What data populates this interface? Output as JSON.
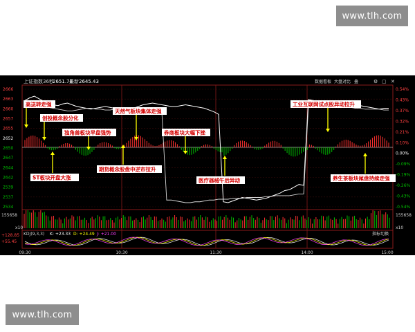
{
  "watermarks": {
    "top": "www.tlh.com",
    "bottom": "www.tlh.com"
  },
  "header": {
    "index_name": "上证指数",
    "index_sub": "36秒",
    "price": "2651.78",
    "label": "最新",
    "value2": "2645.43",
    "right_items": [
      "数据看板",
      "大盘对比",
      "叠"
    ]
  },
  "indicator": {
    "name": "KDJ(9,3,3)",
    "k": "K: +23.33",
    "d": "D: +24.49",
    "j": "J: +21.00",
    "tag": "指标切换",
    "y_labels": [
      "+128.85",
      "+55.45"
    ]
  },
  "volume": {
    "left_label": "155658",
    "right_label": "155658",
    "unit": "x10"
  },
  "colors": {
    "background": "#000000",
    "up": "#ff3030",
    "down": "#00c000",
    "index_line": "#ffffff",
    "avg_line": "#d8d8d8",
    "annotation_bg": "#ffffff",
    "annotation_text": "#d40000",
    "arrow": "#ffff00"
  },
  "chart_data": {
    "type": "line",
    "title": "",
    "xlabel": "",
    "ylabel": "",
    "x_ticks": [
      "09:30",
      "10:30",
      "11:30",
      "14:00",
      "15:00"
    ],
    "y_ticks_left": [
      "2666",
      "2663",
      "2660",
      "2657",
      "2655",
      "2652",
      "2650",
      "2647",
      "2644",
      "2642",
      "2539",
      "2537",
      "2534"
    ],
    "y_ticks_right": [
      "0.54%",
      "0.43%",
      "0.37%",
      "0.32%",
      "0.21%",
      "0.10%",
      "0.00%",
      "-0.09%",
      "-0.19%",
      "-0.26%",
      "-0.43%",
      "-0.54%"
    ],
    "ylim": [
      2533,
      2667
    ],
    "series": [
      {
        "name": "上证指数",
        "values": [
          2655,
          2658,
          2660,
          2657,
          2654,
          2652,
          2650,
          2649,
          2651,
          2652,
          2650,
          2648,
          2647,
          2646,
          2645,
          2646,
          2647,
          2648,
          2647,
          2646,
          2645,
          2644,
          2645,
          2646,
          2648,
          2650,
          2651,
          2652,
          2651,
          2650,
          2649,
          2648,
          2648,
          2649,
          2650,
          2649,
          2648,
          2647,
          2646,
          2644,
          2642,
          2639,
          2538,
          2537,
          2539,
          2541,
          2543,
          2542,
          2541,
          2540,
          2541,
          2542,
          2544,
          2546,
          2548,
          2551,
          2552,
          2555,
          2558,
          2557,
          2656,
          2655,
          2654,
          2653,
          2652,
          2651,
          2650,
          2649,
          2648,
          2650,
          2650,
          2649,
          2648,
          2647,
          2646,
          2645,
          2646,
          2646
        ]
      },
      {
        "name": "均价",
        "values": [
          2650,
          2649,
          2649,
          2648,
          2648,
          2647,
          2646,
          2645,
          2644,
          2643,
          2643,
          2644,
          2645,
          2646,
          2646,
          2645,
          2645,
          2644,
          2644,
          2645,
          2645,
          2644,
          2643,
          2643,
          2642,
          2642,
          2642,
          2641,
          2641,
          2640,
          2540,
          2540,
          2539,
          2538,
          2537,
          2537,
          2538,
          2538,
          2539,
          2540,
          2540,
          2541,
          2541,
          2541,
          2542,
          2542,
          2542,
          2543,
          2543,
          2543,
          2543,
          2544,
          2544,
          2545,
          2545,
          2545,
          2545,
          2546,
          2547,
          2547,
          2648,
          2649,
          2649,
          2648,
          2647,
          2648,
          2648,
          2648,
          2647,
          2647,
          2646,
          2646,
          2645,
          2645,
          2645,
          2645,
          2644,
          2644
        ]
      }
    ],
    "annotations": [
      "高送转走强",
      "创投概念股分化",
      "独角兽板块早盘强势",
      "天然气板块集体走强",
      "ST板块开盘大涨",
      "期货概念股盘中逆市拉升",
      "券商板块大幅下挫",
      "医疗器械午后异动",
      "工业互联网试点股异动拉升",
      "养生茶板块尾盘持续走强"
    ]
  }
}
